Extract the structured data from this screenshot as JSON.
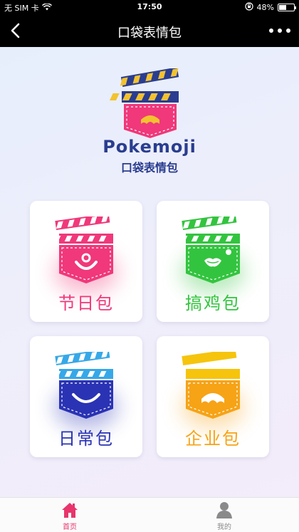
{
  "status_bar": {
    "carrier": "无 SIM 卡",
    "time": "17:50",
    "battery": "48%",
    "battery_level": 0.48
  },
  "nav": {
    "title": "口袋表情包"
  },
  "logo": {
    "word": "Pokemoji",
    "subtitle": "口袋表情包"
  },
  "categories": [
    {
      "label": "节日包",
      "color": "#f0387a"
    },
    {
      "label": "搞鸡包",
      "color": "#33c43f"
    },
    {
      "label": "日常包",
      "color": "#2a33b4"
    },
    {
      "label": "企业包",
      "color": "#f6a316"
    }
  ],
  "tabs": [
    {
      "label": "首页",
      "active": true
    },
    {
      "label": "我的",
      "active": false
    }
  ],
  "colors": {
    "brand_navy": "#2a3d8f",
    "active_tab": "#e8356b",
    "inactive_tab": "#8a8a8a"
  }
}
